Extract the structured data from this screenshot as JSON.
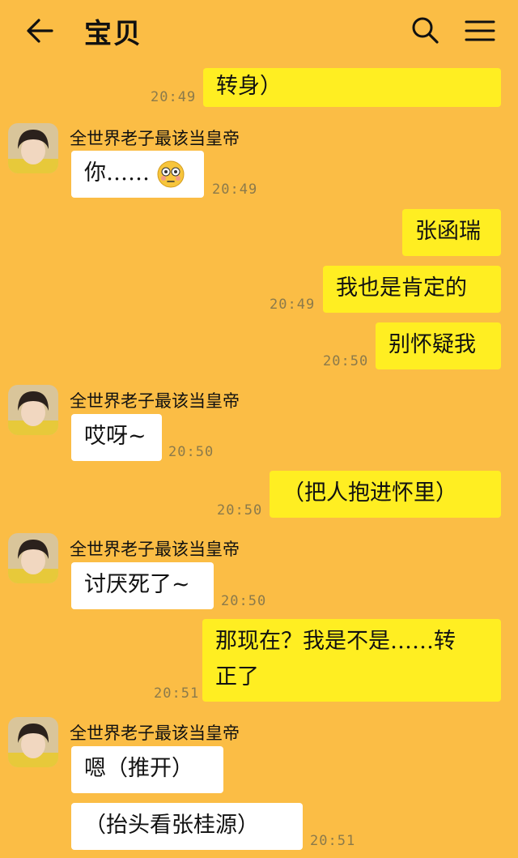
{
  "header": {
    "title": "宝贝",
    "back_icon": "back-arrow-icon",
    "search_icon": "search-icon",
    "menu_icon": "hamburger-menu-icon"
  },
  "sender_name": "全世界老子最该当皇帝",
  "messages": [
    {
      "side": "right",
      "text": "转身）",
      "time": "20:49"
    },
    {
      "side": "left",
      "text": "你……",
      "emoji": "flushed-face",
      "time": "20:49"
    },
    {
      "side": "right",
      "text": "张函瑞",
      "time": ""
    },
    {
      "side": "right",
      "text": "我也是肯定的",
      "time": "20:49"
    },
    {
      "side": "right",
      "text": "别怀疑我",
      "time": "20:50"
    },
    {
      "side": "left",
      "text": "哎呀~",
      "time": "20:50"
    },
    {
      "side": "right",
      "text": "（把人抱进怀里）",
      "time": "20:50"
    },
    {
      "side": "left",
      "text": "讨厌死了~",
      "time": "20:50"
    },
    {
      "side": "right",
      "text": "那现在？我是不是……转",
      "text_line2": "正了",
      "time": "20:51"
    },
    {
      "side": "left",
      "text": "嗯（推开）",
      "time": ""
    },
    {
      "side": "left",
      "text": "（抬头看张桂源）",
      "time": "20:51"
    }
  ],
  "colors": {
    "background": "#fbbd45",
    "outgoing": "#ffee22",
    "incoming": "#ffffff",
    "timestamp": "#8b7a4b"
  }
}
